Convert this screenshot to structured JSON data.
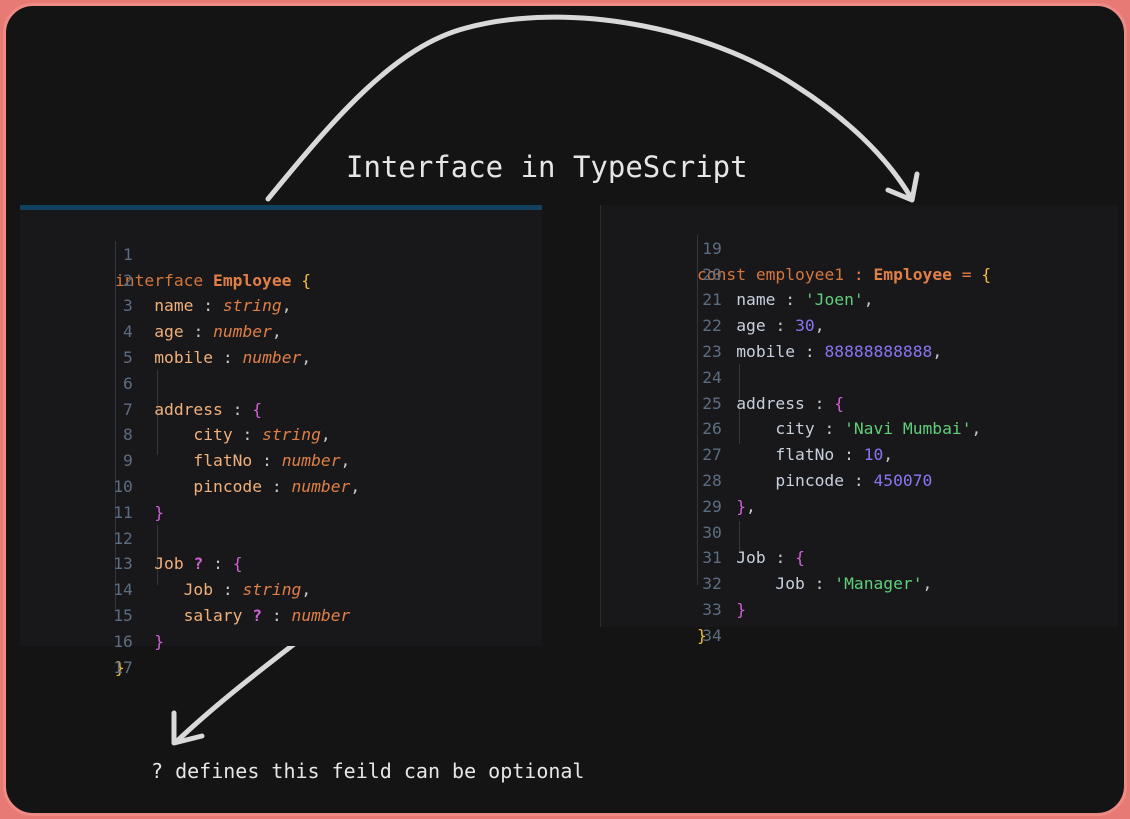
{
  "title": "Interface in TypeScript",
  "note": "? defines this feild can be optional",
  "left_code": {
    "line_numbers": [
      "1",
      "2",
      "3",
      "4",
      "5",
      "6",
      "7",
      "8",
      "9",
      "10",
      "11",
      "12",
      "13",
      "14",
      "15",
      "16",
      "17"
    ],
    "l1": {
      "kw": "interface",
      "type": "Employee",
      "brace": "{"
    },
    "l2": {
      "prop": "name",
      "colon": ":",
      "type": "string",
      "comma": ","
    },
    "l3": {
      "prop": "age",
      "colon": ":",
      "type": "number",
      "comma": ","
    },
    "l4": {
      "prop": "mobile",
      "colon": ":",
      "type": "number",
      "comma": ","
    },
    "l6": {
      "prop": "address",
      "colon": ":",
      "brace": "{"
    },
    "l7": {
      "prop": "city",
      "colon": ":",
      "type": "string",
      "comma": ","
    },
    "l8": {
      "prop": "flatNo",
      "colon": ":",
      "type": "number",
      "comma": ","
    },
    "l9": {
      "prop": "pincode",
      "colon": ":",
      "type": "number",
      "comma": ","
    },
    "l10": {
      "brace": "}"
    },
    "l12": {
      "prop": "Job",
      "optional": "?",
      "colon": ":",
      "brace": "{"
    },
    "l13": {
      "prop": "Job",
      "colon": ":",
      "type": "string",
      "comma": ","
    },
    "l14": {
      "prop": "salary",
      "optional": "?",
      "colon": ":",
      "type": "number"
    },
    "l15": {
      "brace": "}"
    },
    "l16": {
      "brace": "}"
    }
  },
  "right_code": {
    "line_numbers": [
      "19",
      "20",
      "21",
      "22",
      "23",
      "24",
      "25",
      "26",
      "27",
      "28",
      "29",
      "30",
      "31",
      "32",
      "33",
      "34"
    ],
    "l19": {
      "kw": "const",
      "name": "employee1",
      "colon": ":",
      "type": "Employee",
      "eq": "=",
      "brace": "{"
    },
    "l20": {
      "prop": "name",
      "colon": ":",
      "value": "'Joen'",
      "comma": ","
    },
    "l21": {
      "prop": "age",
      "colon": ":",
      "value": "30",
      "comma": ","
    },
    "l22": {
      "prop": "mobile",
      "colon": ":",
      "value": "88888888888",
      "comma": ","
    },
    "l24": {
      "prop": "address",
      "colon": ":",
      "brace": "{"
    },
    "l25": {
      "prop": "city",
      "colon": ":",
      "value": "'Navi Mumbai'",
      "comma": ","
    },
    "l26": {
      "prop": "flatNo",
      "colon": ":",
      "value": "10",
      "comma": ","
    },
    "l27": {
      "prop": "pincode",
      "colon": ":",
      "value": "450070"
    },
    "l28": {
      "brace": "}",
      "comma": ","
    },
    "l30": {
      "prop": "Job",
      "colon": ":",
      "brace": "{"
    },
    "l31": {
      "prop": "Job",
      "colon": ":",
      "value": "'Manager'",
      "comma": ","
    },
    "l32": {
      "brace": "}"
    },
    "l33": {
      "brace": "}"
    }
  },
  "colors": {
    "keyword": "#d5763c",
    "type": "#e07f46",
    "property": "#f0b07a",
    "string": "#5fcf7a",
    "number": "#8a74f0",
    "brace_outer": "#f3bf3b",
    "brace_inner": "#d062d6",
    "background": "#141414",
    "frame_border": "#f08a85"
  }
}
